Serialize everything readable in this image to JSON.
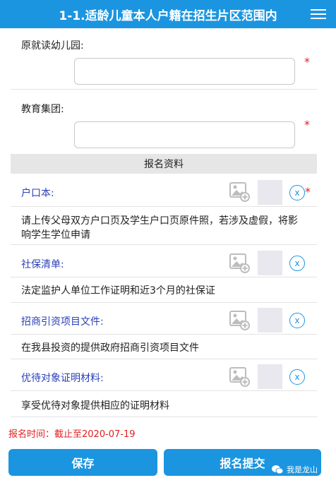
{
  "header": {
    "title": "1-1.适龄儿童本人户籍在招生片区范围内"
  },
  "form": {
    "kindergarten_label": "原就读幼儿园:",
    "kindergarten_value": "",
    "edu_group_label": "教育集团:",
    "edu_group_value": "",
    "required_mark": "*"
  },
  "section": {
    "title": "报名资料"
  },
  "documents": [
    {
      "label": "户口本:",
      "description": "请上传父母双方户口页及学生户口页原件照，若涉及虚假，将影响学生学位申请",
      "required": true
    },
    {
      "label": "社保清单:",
      "description": "法定监护人单位工作证明和近3个月的社保证",
      "required": false
    },
    {
      "label": "招商引资项目文件:",
      "description": "在我县投资的提供政府招商引资项目文件",
      "required": false
    },
    {
      "label": "优待对象证明材料:",
      "description": "享受优待对象提供相应的证明材料",
      "required": false
    }
  ],
  "delete_label": "x",
  "deadline": "报名时间：截止至2020-07-19",
  "buttons": {
    "save": "保存",
    "submit": "报名提交"
  },
  "watermark": "我是龙山",
  "colors": {
    "accent": "#1b95e0",
    "label_blue": "#2b3fb7",
    "required_red": "#e02020"
  },
  "icons": {
    "menu": "menu-icon",
    "image_upload": "image-add-icon",
    "delete": "close-circle-icon"
  }
}
